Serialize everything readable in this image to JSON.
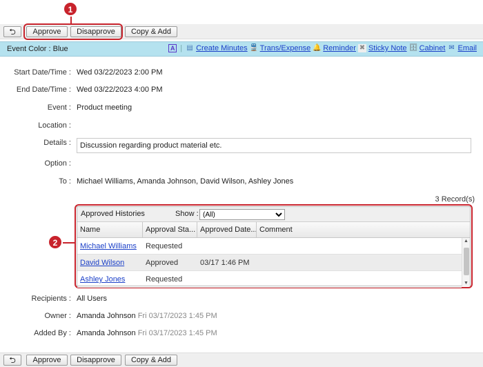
{
  "toolbar": {
    "back_label": "⮌",
    "approve": "Approve",
    "disapprove": "Disapprove",
    "copy_add": "Copy & Add"
  },
  "callouts": {
    "one": "1",
    "two": "2"
  },
  "event_bar": {
    "color_label": "Event Color : Blue",
    "links": {
      "create_minutes": "Create Minutes",
      "trans_expense": "Trans/Expense",
      "reminder": "Reminder",
      "sticky_note": "Sticky Note",
      "cabinet": "Cabinet",
      "email": "Email"
    },
    "icons": {
      "font": "A",
      "minutes": "▤",
      "train": "🚆",
      "bell": "🔔",
      "sticky": "✖",
      "cabinet": "🗄",
      "mail": "✉"
    }
  },
  "fields": {
    "start": {
      "label": "Start Date/Time",
      "value": "Wed 03/22/2023 2:00 PM"
    },
    "end": {
      "label": "End Date/Time",
      "value": "Wed 03/22/2023 4:00 PM"
    },
    "event": {
      "label": "Event",
      "value": "Product meeting"
    },
    "location": {
      "label": "Location",
      "value": ""
    },
    "details": {
      "label": "Details",
      "value": "Discussion regarding product material etc."
    },
    "option": {
      "label": "Option",
      "value": ""
    },
    "to": {
      "label": "To",
      "value": "Michael Williams, Amanda Johnson, David Wilson, Ashley Jones"
    },
    "recipients": {
      "label": "Recipients",
      "value": "All Users"
    },
    "owner": {
      "label": "Owner",
      "name": "Amanda Johnson",
      "time": "Fri 03/17/2023 1:45 PM"
    },
    "added_by": {
      "label": "Added By",
      "name": "Amanda Johnson",
      "time": "Fri 03/17/2023 1:45 PM"
    }
  },
  "records_count": "3 Record(s)",
  "histories": {
    "title": "Approved Histories",
    "show_label": "Show :",
    "show_selected": "(All)",
    "columns": [
      "Name",
      "Approval Sta...",
      "Approved Date...",
      "Comment"
    ],
    "rows": [
      {
        "name": "Michael Williams",
        "status": "Requested",
        "date": "",
        "comment": ""
      },
      {
        "name": "David Wilson",
        "status": "Approved",
        "date": "03/17 1:46 PM",
        "comment": ""
      },
      {
        "name": "Ashley Jones",
        "status": "Requested",
        "date": "",
        "comment": ""
      }
    ]
  },
  "colors": {
    "callout": "#c8232c",
    "event_bar": "#b5e2ef",
    "link": "#1a3fc8"
  }
}
